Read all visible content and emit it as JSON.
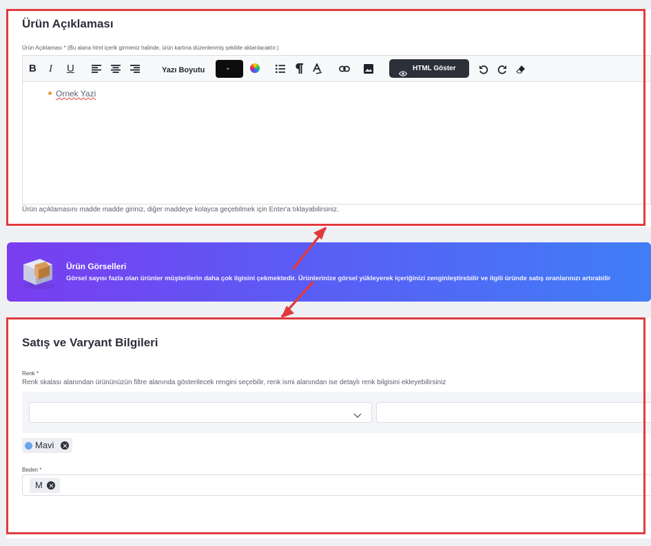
{
  "description_section": {
    "title": "Ürün Açıklaması",
    "field_hint": "Ürün Açıklaması * (Bu alana html içerik girmeniz halinde, ürün kartına düzenlenmiş şekilde aktarılacaktır.)",
    "toolbar": {
      "bold": "B",
      "italic": "I",
      "underline": "U",
      "font_size_label": "Yazı Boyutu",
      "html_button_label": "HTML Göster",
      "icons": [
        "align-left-icon",
        "align-center-icon",
        "align-right-icon",
        "color-dropdown",
        "palette-icon",
        "list-icon",
        "paragraph-icon",
        "text-format-icon",
        "link-icon",
        "image-icon",
        "eye-icon",
        "undo-icon",
        "redo-icon",
        "eraser-icon"
      ]
    },
    "content_bullet": "Ornek Yazi",
    "help_text": "Ürün açıklamasını madde madde giriniz, diğer maddeye kolayca geçebilmek için Enter'a tıklayabilirsiniz."
  },
  "images_banner": {
    "title": "Ürün Görselleri",
    "text": "Görsel sayısı fazla olan ürünler müşterilerin daha çok ilgisini çekmektedir. Ürünlerinize görsel yükleyerek içeriğinizi zenginleştirebilir ve ilgili üründe satış oranlarınızı artırabilir"
  },
  "sales_section": {
    "title": "Satış ve Varyant Bilgileri",
    "color_label": "Renk *",
    "color_hint": "Renk skalası alanından ürününüzün filtre alanında gösterilecek rengini seçebilir, renk ismi alanından ise detaylı renk bilgisini ekleyebilirsiniz",
    "color_select_value": "",
    "color_name_value": "",
    "selected_colors": [
      {
        "name": "Mavi",
        "swatch": "#6aa3ee"
      }
    ],
    "size_label": "Beden *",
    "selected_sizes": [
      "M"
    ]
  },
  "colors": {
    "annotation_red": "#e03a3e",
    "banner_gradient": [
      "#7a3df0",
      "#5b5cf5",
      "#3f7ef7"
    ],
    "html_button_bg": "#2c3038"
  }
}
